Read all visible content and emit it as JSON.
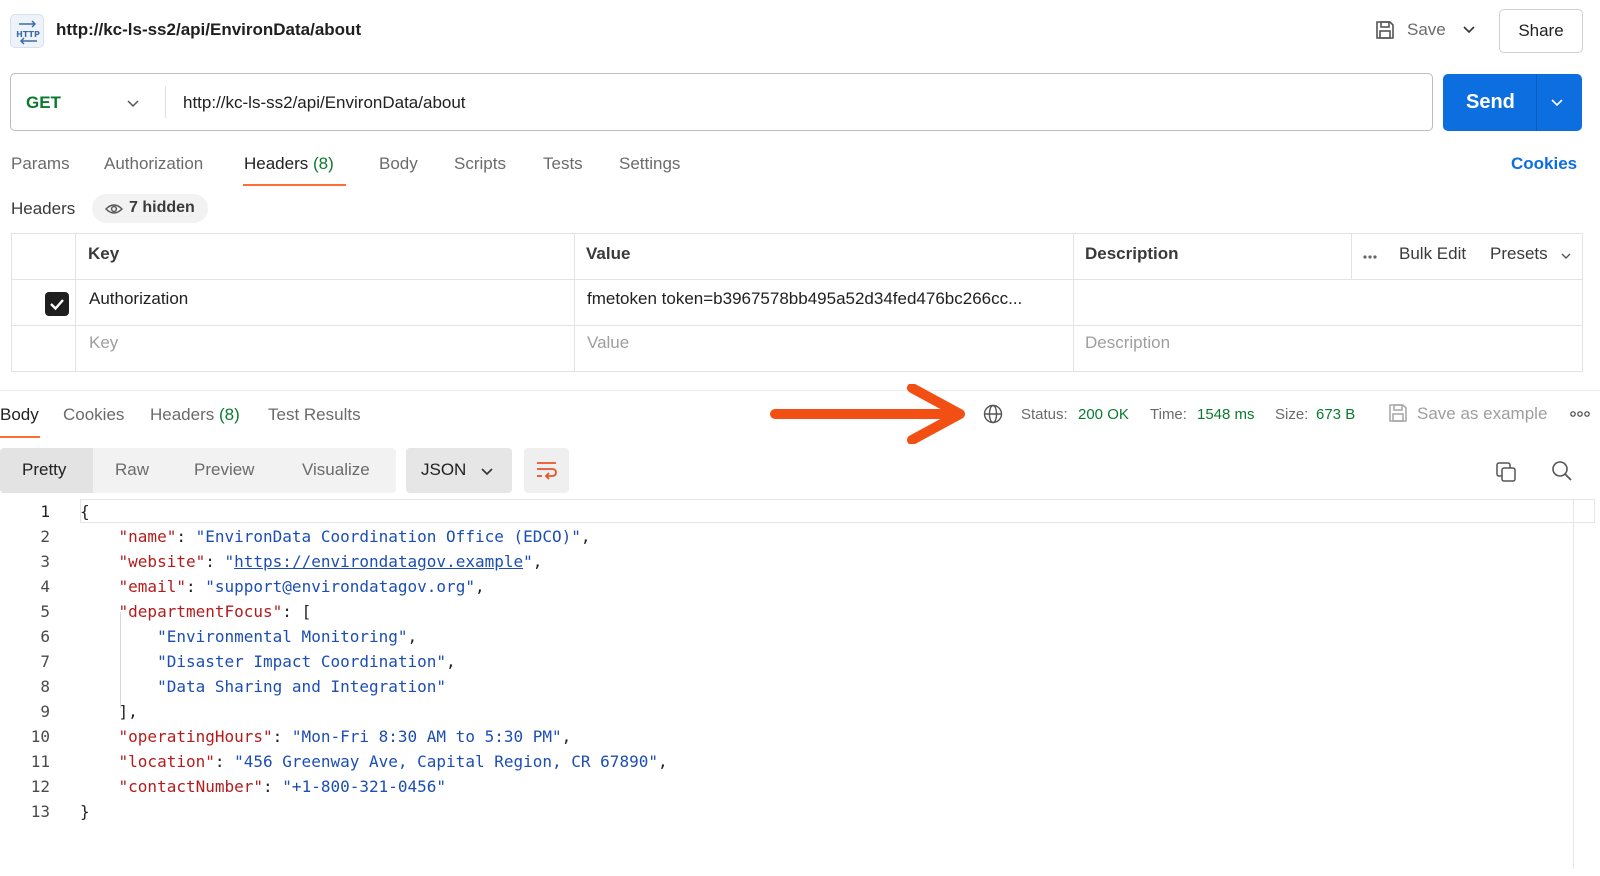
{
  "title_bar": {
    "icon_text": "HTTP",
    "title": "http://kc-ls-ss2/api/EnvironData/about",
    "save_label": "Save",
    "share_label": "Share"
  },
  "request": {
    "method": "GET",
    "url": "http://kc-ls-ss2/api/EnvironData/about",
    "send_label": "Send"
  },
  "request_tabs": {
    "params": "Params",
    "authorization": "Authorization",
    "headers": "Headers",
    "headers_count": "(8)",
    "body": "Body",
    "scripts": "Scripts",
    "tests": "Tests",
    "settings": "Settings",
    "cookies": "Cookies"
  },
  "headers_section": {
    "label": "Headers",
    "hidden": "7 hidden"
  },
  "headers_table": {
    "col_key": "Key",
    "col_value": "Value",
    "col_description": "Description",
    "bulk_edit": "Bulk Edit",
    "presets": "Presets",
    "row_key": "Authorization",
    "row_value": "fmetoken token=b3967578bb495a52d34fed476bc266cc...",
    "placeholder_key": "Key",
    "placeholder_value": "Value",
    "placeholder_description": "Description"
  },
  "response_tabs": {
    "body": "Body",
    "cookies": "Cookies",
    "headers": "Headers",
    "headers_count": "(8)",
    "test_results": "Test Results"
  },
  "status": {
    "status_label": "Status:",
    "status_value": "200 OK",
    "time_label": "Time:",
    "time_value": "1548 ms",
    "size_label": "Size:",
    "size_value": "673 B",
    "save_example": "Save as example"
  },
  "body_toolbar": {
    "pretty": "Pretty",
    "raw": "Raw",
    "preview": "Preview",
    "visualize": "Visualize",
    "format": "JSON"
  },
  "code": {
    "line_numbers": [
      "1",
      "2",
      "3",
      "4",
      "5",
      "6",
      "7",
      "8",
      "9",
      "10",
      "11",
      "12",
      "13"
    ],
    "open_brace": "{",
    "close_brace": "}",
    "name_key": "\"name\"",
    "name_val": "\"EnvironData Coordination Office (EDCO)\"",
    "website_key": "\"website\"",
    "website_val": "https://environdatagov.example",
    "email_key": "\"email\"",
    "email_val": "\"support@environdatagov.org\"",
    "dept_key": "\"departmentFocus\"",
    "dept_1": "\"Environmental Monitoring\"",
    "dept_2": "\"Disaster Impact Coordination\"",
    "dept_3": "\"Data Sharing and Integration\"",
    "hours_key": "\"operatingHours\"",
    "hours_val": "\"Mon-Fri 8:30 AM to 5:30 PM\"",
    "location_key": "\"location\"",
    "location_val": "\"456 Greenway Ave, Capital Region, CR 67890\"",
    "contact_key": "\"contactNumber\"",
    "contact_val": "\"+1-800-321-0456\""
  }
}
